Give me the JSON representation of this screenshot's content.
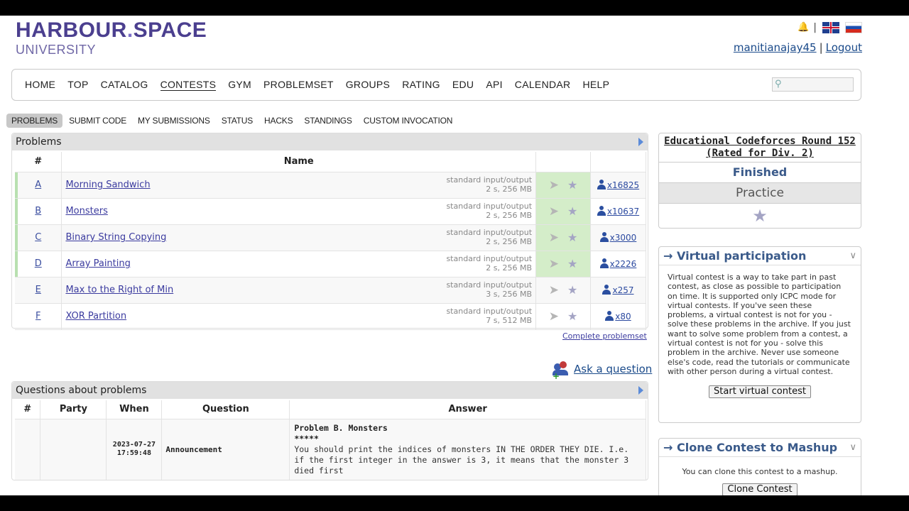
{
  "header": {
    "logo_line1_a": "HARBOUR",
    "logo_line1_dot": ".",
    "logo_line1_b": "SPACE",
    "logo_line2": "UNIVERSITY",
    "username": "manitianajay45",
    "logout": "Logout"
  },
  "nav": {
    "items": [
      "HOME",
      "TOP",
      "CATALOG",
      "CONTESTS",
      "GYM",
      "PROBLEMSET",
      "GROUPS",
      "RATING",
      "EDU",
      "API",
      "CALENDAR",
      "HELP"
    ],
    "active": "CONTESTS"
  },
  "subnav": {
    "items": [
      "PROBLEMS",
      "SUBMIT CODE",
      "MY SUBMISSIONS",
      "STATUS",
      "HACKS",
      "STANDINGS",
      "CUSTOM INVOCATION"
    ],
    "selected": "PROBLEMS"
  },
  "problems": {
    "title": "Problems",
    "col_index": "#",
    "col_name": "Name",
    "rows": [
      {
        "index": "A",
        "name": "Morning Sandwich",
        "io": "standard input/output",
        "limits": "2 s, 256 MB",
        "solved": "x16825",
        "accepted": true
      },
      {
        "index": "B",
        "name": "Monsters",
        "io": "standard input/output",
        "limits": "2 s, 256 MB",
        "solved": "x10637",
        "accepted": true
      },
      {
        "index": "C",
        "name": "Binary String Copying",
        "io": "standard input/output",
        "limits": "2 s, 256 MB",
        "solved": "x3000",
        "accepted": true
      },
      {
        "index": "D",
        "name": "Array Painting",
        "io": "standard input/output",
        "limits": "2 s, 256 MB",
        "solved": "x2226",
        "accepted": true
      },
      {
        "index": "E",
        "name": "Max to the Right of Min",
        "io": "standard input/output",
        "limits": "3 s, 256 MB",
        "solved": "x257",
        "accepted": false
      },
      {
        "index": "F",
        "name": "XOR Partition",
        "io": "standard input/output",
        "limits": "7 s, 512 MB",
        "solved": "x80",
        "accepted": false
      }
    ],
    "complete_link": "Complete problemset"
  },
  "ask_question": "Ask a question",
  "questions": {
    "title": "Questions about problems",
    "col_index": "#",
    "col_party": "Party",
    "col_when": "When",
    "col_question": "Question",
    "col_answer": "Answer",
    "row": {
      "when_date": "2023-07-27",
      "when_time": "17:59:48",
      "question": "Announcement",
      "answer_title": "Problem B. Monsters",
      "answer_stars": "*****",
      "answer_text": "You should print the indices of monsters IN THE ORDER THEY DIE. I.e. if the first integer in the answer is 3, it means that the monster 3 died first"
    }
  },
  "sidebar": {
    "contest_name": "Educational Codeforces Round 152 (Rated for Div. 2)",
    "status": "Finished",
    "mode": "Practice",
    "virtual": {
      "title": "→ Virtual participation",
      "text": "Virtual contest is a way to take part in past contest, as close as possible to participation on time. It is supported only ICPC mode for virtual contests. If you've seen these problems, a virtual contest is not for you - solve these problems in the archive. If you just want to solve some problem from a contest, a virtual contest is not for you - solve this problem in the archive. Never use someone else's code, read the tutorials or communicate with other person during a virtual contest.",
      "button": "Start virtual contest"
    },
    "clone": {
      "title": "→ Clone Contest to Mashup",
      "text": "You can clone this contest to a mashup.",
      "button": "Clone Contest"
    }
  }
}
